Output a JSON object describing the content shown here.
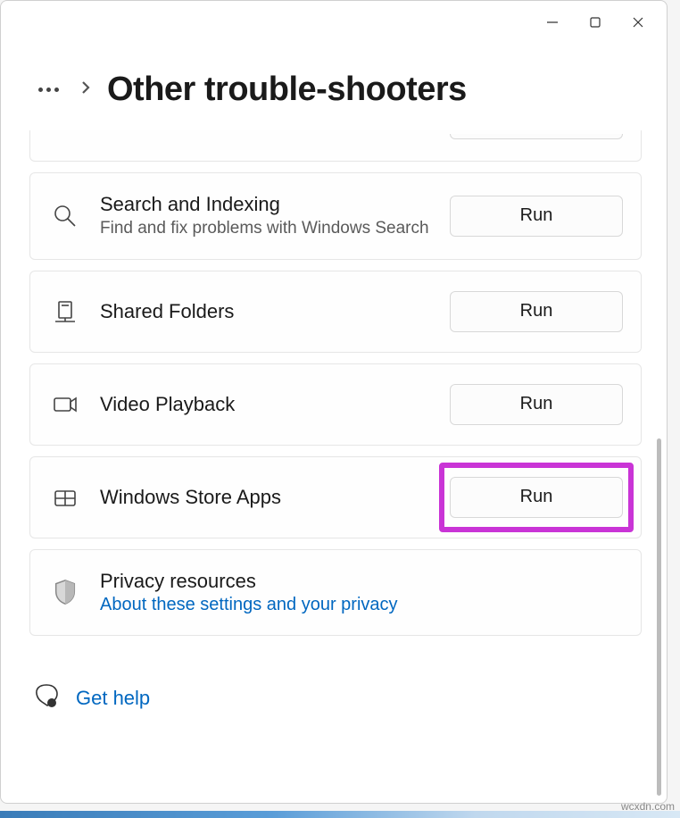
{
  "window": {
    "title": "Other trouble-shooters"
  },
  "items": {
    "search": {
      "title": "Search and Indexing",
      "desc": "Find and fix problems with Windows Search",
      "run": "Run"
    },
    "shared": {
      "title": "Shared Folders",
      "run": "Run"
    },
    "video": {
      "title": "Video Playback",
      "run": "Run"
    },
    "store": {
      "title": "Windows Store Apps",
      "run": "Run"
    },
    "privacy": {
      "title": "Privacy resources",
      "link": "About these settings and your privacy"
    }
  },
  "footer": {
    "help": "Get help"
  },
  "watermark": "wcxdn.com"
}
